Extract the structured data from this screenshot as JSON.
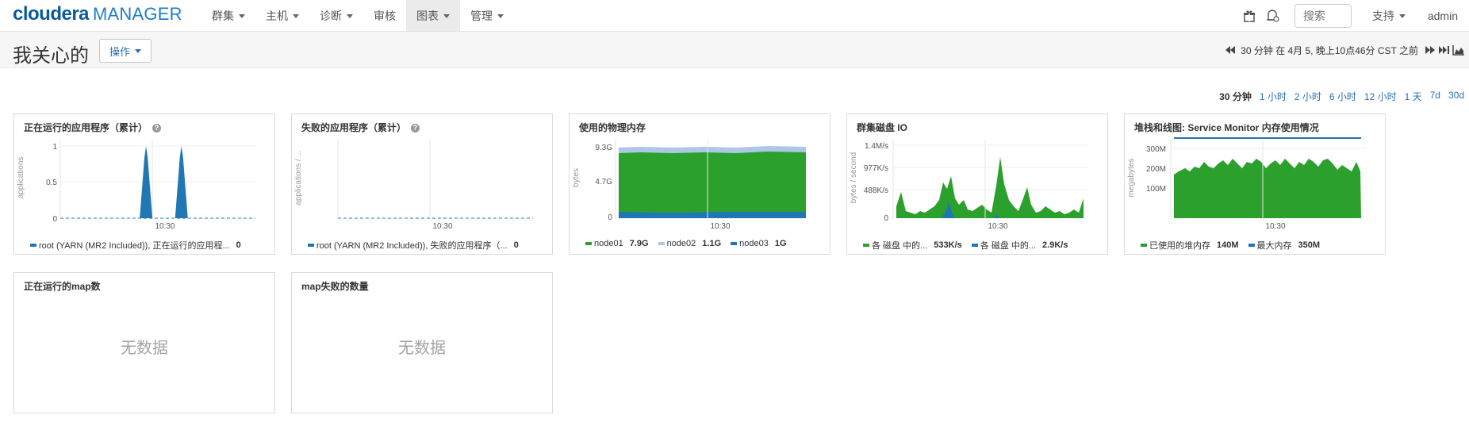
{
  "brand": {
    "part1": "cloudera",
    "part2": "MANAGER"
  },
  "nav": {
    "items": [
      {
        "label": "群集",
        "dropdown": true
      },
      {
        "label": "主机",
        "dropdown": true
      },
      {
        "label": "诊断",
        "dropdown": true
      },
      {
        "label": "审核",
        "dropdown": false
      },
      {
        "label": "图表",
        "dropdown": true,
        "active": true
      },
      {
        "label": "管理",
        "dropdown": true
      }
    ],
    "right": {
      "gift_icon": "gift-icon",
      "running_commands_icon": "running-commands-icon",
      "search_placeholder": "搜索",
      "support_label": "支持",
      "user_label": "admin"
    }
  },
  "page": {
    "title": "我关心的",
    "actions_label": "操作",
    "time_text": "30 分钟 在 4月 5, 晚上10点46分 CST 之前"
  },
  "time_ranges": [
    "30 分钟",
    "1 小时",
    "2 小时",
    "6 小时",
    "12 小时",
    "1 天",
    "7d",
    "30d"
  ],
  "panels": [
    {
      "title": "正在运行的应用程序（累计）",
      "help": "?",
      "no_data": null,
      "chart_data": {
        "type": "area",
        "ylabel": "applications",
        "ylim": [
          0,
          1
        ],
        "yticks": [
          "1",
          "0.5",
          "0"
        ],
        "xticks": [
          "10:30"
        ],
        "series": [
          {
            "name": "root (YARN (MR2 Included)), 正在运行的应用程...",
            "value": "0",
            "color": "#1f77b4",
            "points": [
              0,
              0,
              0,
              0,
              0,
              0,
              0,
              0,
              0,
              0,
              0,
              0,
              0,
              0,
              0,
              0,
              0,
              0,
              0,
              0,
              0,
              1,
              0,
              0,
              0,
              0,
              0,
              0,
              0,
              0,
              1,
              0,
              0,
              0,
              0,
              0,
              0,
              0,
              0,
              0,
              0,
              0,
              0,
              0,
              0,
              0,
              0,
              0,
              0
            ]
          }
        ]
      }
    },
    {
      "title": "失败的应用程序（累计）",
      "help": "?",
      "no_data": null,
      "chart_data": {
        "type": "line",
        "ylabel": "applications / ...",
        "yticks": [],
        "xticks": [
          "10:30"
        ],
        "series": [
          {
            "name": "root (YARN (MR2 Included)), 失败的应用程序（...",
            "value": "0",
            "color": "#1f77b4",
            "points": [
              0,
              0
            ]
          }
        ]
      }
    },
    {
      "title": "使用的物理内存",
      "help": null,
      "no_data": null,
      "chart_data": {
        "type": "area",
        "stacked": true,
        "ylabel": "bytes",
        "yticks": [
          "9.3G",
          "4.7G",
          "0"
        ],
        "xticks": [
          "10:30"
        ],
        "series": [
          {
            "name": "node01",
            "value": "7.9G",
            "color": "#2ca02c"
          },
          {
            "name": "node02",
            "value": "1.1G",
            "color": "#aec7e8"
          },
          {
            "name": "node03",
            "value": "1G",
            "color": "#1f77b4"
          }
        ]
      }
    },
    {
      "title": "群集磁盘 IO",
      "help": null,
      "no_data": null,
      "chart_data": {
        "type": "area",
        "ylabel": "bytes / second",
        "yticks": [
          "1.4M/s",
          "977K/s",
          "488K/s",
          "0"
        ],
        "xticks": [
          "10:30"
        ],
        "series": [
          {
            "name": "各 磁盘 中的...",
            "value": "533K/s",
            "color": "#2ca02c"
          },
          {
            "name": "各 磁盘 中的...",
            "value": "2.9K/s",
            "color": "#1f77b4"
          }
        ]
      }
    },
    {
      "title": "堆栈和线图: Service Monitor 内存使用情况",
      "help": null,
      "no_data": null,
      "chart_data": {
        "type": "area",
        "ylabel": "megabytes",
        "yticks": [
          "300M",
          "200M",
          "100M"
        ],
        "xticks": [
          "10:30"
        ],
        "series": [
          {
            "name": "已使用的堆内存",
            "value": "140M",
            "color": "#2ca02c"
          },
          {
            "name": "最大内存",
            "value": "350M",
            "color": "#1f77b4"
          }
        ]
      }
    },
    {
      "title": "正在运行的map数",
      "help": null,
      "no_data": "无数据"
    },
    {
      "title": "map失败的数量",
      "help": null,
      "no_data": "无数据"
    }
  ]
}
